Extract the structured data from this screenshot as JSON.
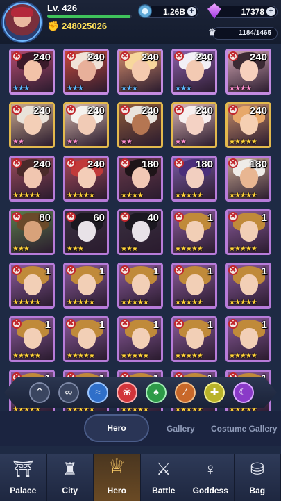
{
  "player": {
    "level_label": "Lv. 426",
    "xp_fraction": 0.98,
    "power": "248025026"
  },
  "resources": {
    "coins": "1.26B",
    "gems": "17378",
    "heroes": "1184/1465"
  },
  "heroes": [
    {
      "level": "240",
      "stars": 3,
      "star_color": "#5db8ff",
      "bg": "#b24a6e",
      "hair": "#3a1a2a",
      "skin": "#f2c2a8",
      "border": "#c38ae0"
    },
    {
      "level": "240",
      "stars": 3,
      "star_color": "#5db8ff",
      "bg": "#c84a3c",
      "hair": "#f1e3d8",
      "skin": "#e8b09a",
      "border": "#c38ae0"
    },
    {
      "level": "240",
      "stars": 3,
      "star_color": "#5db8ff",
      "bg": "#d08a6a",
      "hair": "#f7d79c",
      "skin": "#f4c9ae",
      "border": "#c38ae0"
    },
    {
      "level": "240",
      "stars": 3,
      "star_color": "#5db8ff",
      "bg": "#8a5ea8",
      "hair": "#f2f0f6",
      "skin": "#f3cab3",
      "border": "#c38ae0"
    },
    {
      "level": "240",
      "stars": 4,
      "star_color": "#ff8fd0",
      "bg": "#d2a6b2",
      "hair": "#3b2a34",
      "skin": "#f6d0bd",
      "border": "#c38ae0"
    },
    {
      "level": "240",
      "stars": 2,
      "star_color": "#ff8fd0",
      "bg": "#c7a88e",
      "hair": "#e9e3da",
      "skin": "#f3cfb7",
      "border": "#e3b94d"
    },
    {
      "level": "240",
      "stars": 2,
      "star_color": "#ff8fd0",
      "bg": "#d7b8ac",
      "hair": "#f5f2ee",
      "skin": "#f1cbb6",
      "border": "#e3b94d"
    },
    {
      "level": "240",
      "stars": 2,
      "star_color": "#ff8fd0",
      "bg": "#8e5a3a",
      "hair": "#e9e4dd",
      "skin": "#b57652",
      "border": "#e3b94d"
    },
    {
      "level": "240",
      "stars": 2,
      "star_color": "#ff8fd0",
      "bg": "#d9b2b2",
      "hair": "#f6efef",
      "skin": "#f4d2c4",
      "border": "#e3b94d"
    },
    {
      "level": "240",
      "stars": 5,
      "star_color": "#ffd23a",
      "bg": "#c98e6a",
      "hair": "#e7a86a",
      "skin": "#f5cfb2",
      "border": "#e3b94d"
    },
    {
      "level": "240",
      "stars": 5,
      "star_color": "#ffd23a",
      "bg": "#9a4a5a",
      "hair": "#4a2a2a",
      "skin": "#f1c6b0",
      "border": "#b77bd9"
    },
    {
      "level": "240",
      "stars": 5,
      "star_color": "#ffd23a",
      "bg": "#a84a5a",
      "hair": "#c13a3a",
      "skin": "#f3cdb8",
      "border": "#b77bd9"
    },
    {
      "level": "180",
      "stars": 4,
      "star_color": "#ffd23a",
      "bg": "#6a3a4a",
      "hair": "#1e1418",
      "skin": "#f1c8b5",
      "border": "#b77bd9"
    },
    {
      "level": "180",
      "stars": 5,
      "star_color": "#ffd23a",
      "bg": "#7a5aa6",
      "hair": "#4b2f7a",
      "skin": "#f2cfc0",
      "border": "#b77bd9"
    },
    {
      "level": "180",
      "stars": 5,
      "star_color": "#ffd23a",
      "bg": "#c8a890",
      "hair": "#efece8",
      "skin": "#e8b692",
      "border": "#b77bd9"
    },
    {
      "level": "80",
      "stars": 3,
      "star_color": "#ffd23a",
      "bg": "#5a7a4a",
      "hair": "#6a4a2a",
      "skin": "#d8a27a",
      "border": "#b77bd9"
    },
    {
      "level": "60",
      "stars": 3,
      "star_color": "#ffd23a",
      "bg": "#3a3040",
      "hair": "#1b1820",
      "skin": "#e8e2e8",
      "border": "#b77bd9"
    },
    {
      "level": "40",
      "stars": 3,
      "star_color": "#ffd23a",
      "bg": "#3a3040",
      "hair": "#1b1820",
      "skin": "#e8e2e8",
      "border": "#b77bd9"
    },
    {
      "level": "1",
      "stars": 5,
      "star_color": "#ffd23a",
      "bg": "#8a5a9a",
      "hair": "#c08a3a",
      "skin": "#f2cfb6",
      "border": "#b77bd9"
    },
    {
      "level": "1",
      "stars": 5,
      "star_color": "#ffd23a",
      "bg": "#8a5a9a",
      "hair": "#c08a3a",
      "skin": "#f2cfb6",
      "border": "#b77bd9"
    },
    {
      "level": "1",
      "stars": 5,
      "star_color": "#ffd23a",
      "bg": "#8a5a9a",
      "hair": "#c08a3a",
      "skin": "#f2cfb6",
      "border": "#b77bd9"
    },
    {
      "level": "1",
      "stars": 5,
      "star_color": "#ffd23a",
      "bg": "#8a5a9a",
      "hair": "#c08a3a",
      "skin": "#f2cfb6",
      "border": "#b77bd9"
    },
    {
      "level": "1",
      "stars": 5,
      "star_color": "#ffd23a",
      "bg": "#8a5a9a",
      "hair": "#c08a3a",
      "skin": "#f2cfb6",
      "border": "#b77bd9"
    },
    {
      "level": "1",
      "stars": 5,
      "star_color": "#ffd23a",
      "bg": "#8a5a9a",
      "hair": "#c08a3a",
      "skin": "#f2cfb6",
      "border": "#b77bd9"
    },
    {
      "level": "1",
      "stars": 5,
      "star_color": "#ffd23a",
      "bg": "#8a5a9a",
      "hair": "#c08a3a",
      "skin": "#f2cfb6",
      "border": "#b77bd9"
    },
    {
      "level": "1",
      "stars": 5,
      "star_color": "#ffd23a",
      "bg": "#8a5a9a",
      "hair": "#c08a3a",
      "skin": "#f2cfb6",
      "border": "#b77bd9"
    },
    {
      "level": "1",
      "stars": 5,
      "star_color": "#ffd23a",
      "bg": "#8a5a9a",
      "hair": "#c08a3a",
      "skin": "#f2cfb6",
      "border": "#b77bd9"
    },
    {
      "level": "1",
      "stars": 5,
      "star_color": "#ffd23a",
      "bg": "#8a5a9a",
      "hair": "#c08a3a",
      "skin": "#f2cfb6",
      "border": "#b77bd9"
    },
    {
      "level": "1",
      "stars": 5,
      "star_color": "#ffd23a",
      "bg": "#8a5a9a",
      "hair": "#c08a3a",
      "skin": "#f2cfb6",
      "border": "#b77bd9"
    },
    {
      "level": "1",
      "stars": 5,
      "star_color": "#ffd23a",
      "bg": "#8a5a9a",
      "hair": "#c08a3a",
      "skin": "#f2cfb6",
      "border": "#b77bd9"
    },
    {
      "level": "1",
      "stars": 5,
      "star_color": "#ffd23a",
      "bg": "#8a5a9a",
      "hair": "#c08a3a",
      "skin": "#f2cfb6",
      "border": "#b77bd9"
    },
    {
      "level": "1",
      "stars": 5,
      "star_color": "#ffd23a",
      "bg": "#8a5a9a",
      "hair": "#c08a3a",
      "skin": "#f2cfb6",
      "border": "#b77bd9"
    },
    {
      "level": "1",
      "stars": 5,
      "star_color": "#ffd23a",
      "bg": "#8a5a9a",
      "hair": "#c08a3a",
      "skin": "#f2cfb6",
      "border": "#b77bd9"
    },
    {
      "level": "1",
      "stars": 5,
      "star_color": "#ffd23a",
      "bg": "#8a5a9a",
      "hair": "#c08a3a",
      "skin": "#f2cfb6",
      "border": "#b77bd9"
    },
    {
      "level": "1",
      "stars": 5,
      "star_color": "#ffd23a",
      "bg": "#8a5a9a",
      "hair": "#c08a3a",
      "skin": "#f2cfb6",
      "border": "#b77bd9"
    }
  ],
  "filters": [
    {
      "icon": "chevron-up-icon",
      "glyph": "⌃",
      "bg": "#3a4560",
      "border": "#7d88a6"
    },
    {
      "icon": "infinity-icon",
      "glyph": "∞",
      "bg": "#3a4560",
      "border": "#7d88a6"
    },
    {
      "icon": "wave-icon",
      "glyph": "≈",
      "bg": "#2f6fc9",
      "border": "#9cc6ff"
    },
    {
      "icon": "fire-element-icon",
      "glyph": "❀",
      "bg": "#d2343a",
      "border": "#ffb0b0"
    },
    {
      "icon": "nature-element-icon",
      "glyph": "♠",
      "bg": "#2e9a48",
      "border": "#a6f0b8"
    },
    {
      "icon": "claw-element-icon",
      "glyph": "∕",
      "bg": "#c8682a",
      "border": "#f5c08a"
    },
    {
      "icon": "light-element-icon",
      "glyph": "✚",
      "bg": "#b9b32a",
      "border": "#f3ee8a"
    },
    {
      "icon": "moon-element-icon",
      "glyph": "☾",
      "bg": "#8a3ac8",
      "border": "#d9a8ff"
    }
  ],
  "subtabs": {
    "hero": "Hero",
    "gallery": "Gallery",
    "costume_gallery": "Costume Gallery"
  },
  "nav": [
    {
      "key": "palace",
      "label": "Palace",
      "icon": "palace-icon",
      "glyph": "⛩"
    },
    {
      "key": "city",
      "label": "City",
      "icon": "city-icon",
      "glyph": "♜"
    },
    {
      "key": "hero",
      "label": "Hero",
      "icon": "hero-helmet-icon",
      "glyph": "♕"
    },
    {
      "key": "battle",
      "label": "Battle",
      "icon": "crossed-swords-icon",
      "glyph": "⚔"
    },
    {
      "key": "goddess",
      "label": "Goddess",
      "icon": "goddess-icon",
      "glyph": "♀"
    },
    {
      "key": "bag",
      "label": "Bag",
      "icon": "bag-icon",
      "glyph": "⛁"
    }
  ],
  "active_nav": "hero"
}
